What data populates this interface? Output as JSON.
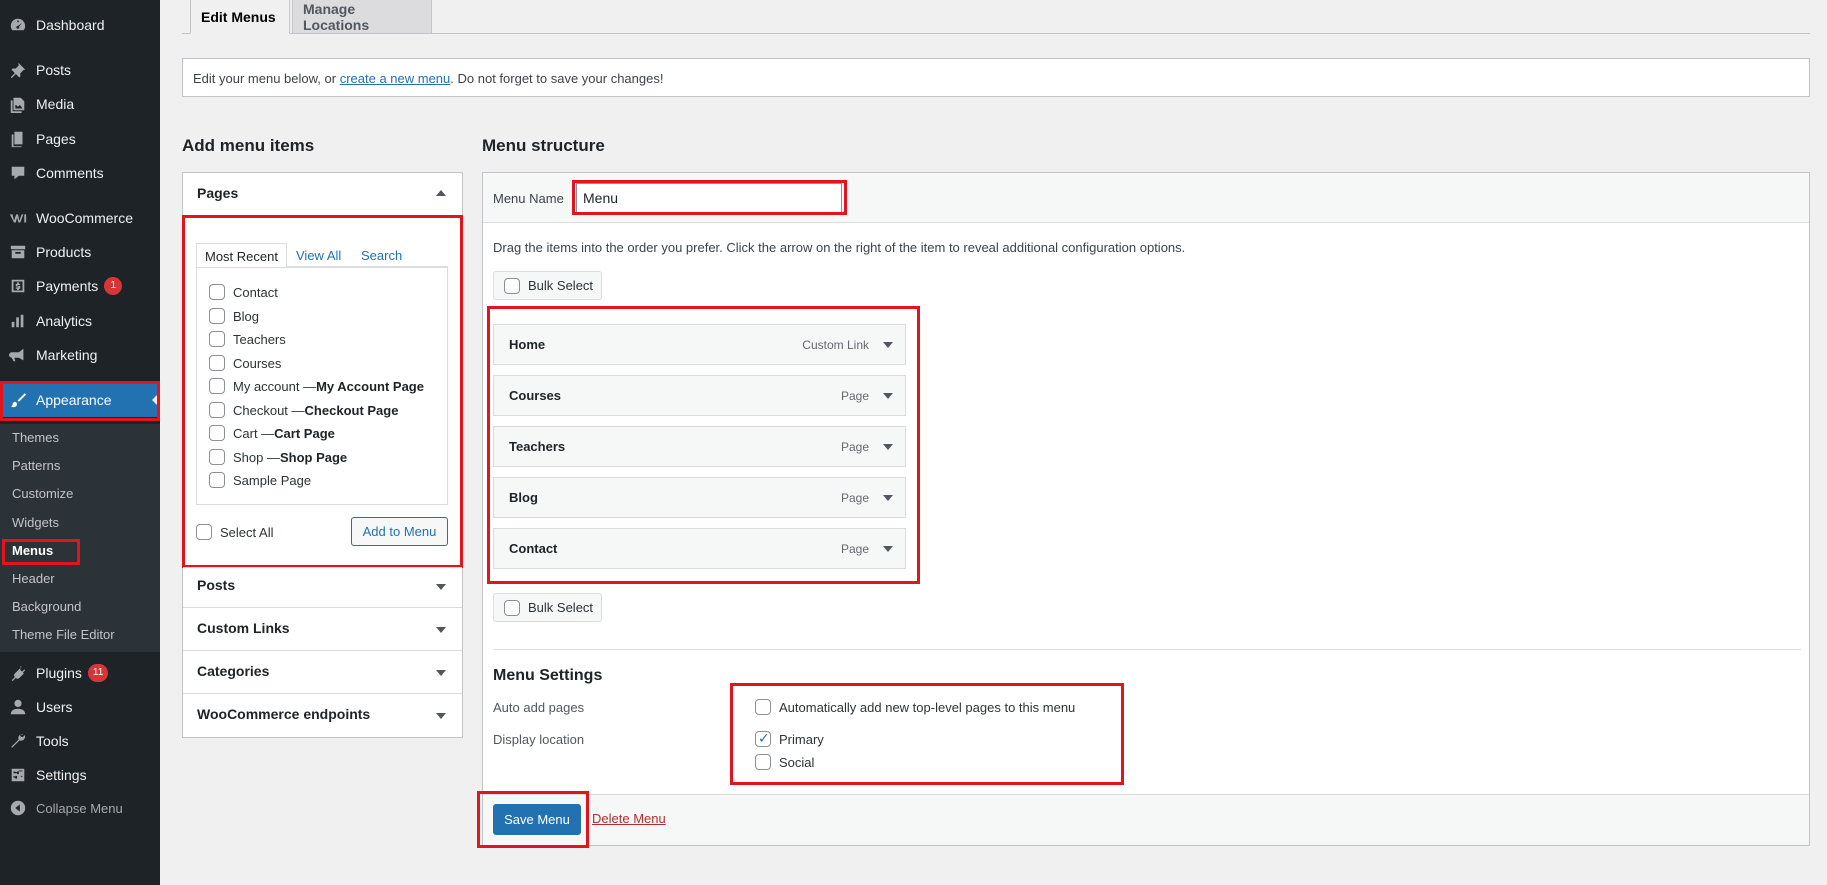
{
  "sidebar": {
    "items": [
      {
        "label": "Dashboard",
        "icon": "dashboard-icon"
      },
      {
        "label": "Posts",
        "icon": "pushpin-icon"
      },
      {
        "label": "Media",
        "icon": "media-icon"
      },
      {
        "label": "Pages",
        "icon": "pages-icon"
      },
      {
        "label": "Comments",
        "icon": "comment-icon"
      },
      {
        "label": "WooCommerce",
        "icon": "woocommerce-icon"
      },
      {
        "label": "Products",
        "icon": "archive-icon"
      },
      {
        "label": "Payments",
        "icon": "payments-icon",
        "badge": "1"
      },
      {
        "label": "Analytics",
        "icon": "bar-chart-icon"
      },
      {
        "label": "Marketing",
        "icon": "megaphone-icon"
      },
      {
        "label": "Appearance",
        "icon": "paintbrush-icon"
      },
      {
        "label": "Plugins",
        "icon": "plugin-icon",
        "badge": "11"
      },
      {
        "label": "Users",
        "icon": "user-icon"
      },
      {
        "label": "Tools",
        "icon": "wrench-icon"
      },
      {
        "label": "Settings",
        "icon": "settings-icon"
      },
      {
        "label": "Collapse Menu",
        "icon": "collapse-icon"
      }
    ],
    "appearance_submenu": [
      "Themes",
      "Patterns",
      "Customize",
      "Widgets",
      "Menus",
      "Header",
      "Background",
      "Theme File Editor"
    ]
  },
  "tabs": [
    "Edit Menus",
    "Manage Locations"
  ],
  "notice": {
    "before": "Edit your menu below, or ",
    "link": "create a new menu",
    "after": ". Do not forget to save your changes!"
  },
  "add_items": {
    "heading": "Add menu items",
    "pages": {
      "title": "Pages",
      "subtabs": [
        "Most Recent",
        "View All",
        "Search"
      ],
      "items": [
        {
          "label": "Contact",
          "suffix": ""
        },
        {
          "label": "Blog",
          "suffix": ""
        },
        {
          "label": "Teachers",
          "suffix": ""
        },
        {
          "label": "Courses",
          "suffix": ""
        },
        {
          "label": "My account — ",
          "suffix": "My Account Page"
        },
        {
          "label": "Checkout — ",
          "suffix": "Checkout Page"
        },
        {
          "label": "Cart — ",
          "suffix": "Cart Page"
        },
        {
          "label": "Shop — ",
          "suffix": "Shop Page"
        },
        {
          "label": "Sample Page",
          "suffix": ""
        }
      ],
      "select_all": "Select All",
      "add_button": "Add to Menu"
    },
    "other_sections": [
      "Posts",
      "Custom Links",
      "Categories",
      "WooCommerce endpoints"
    ]
  },
  "structure": {
    "heading": "Menu structure",
    "menu_name_label": "Menu Name",
    "menu_name_value": "Menu",
    "instructions": "Drag the items into the order you prefer. Click the arrow on the right of the item to reveal additional configuration options.",
    "bulk_select": "Bulk Select",
    "items": [
      {
        "title": "Home",
        "type": "Custom Link"
      },
      {
        "title": "Courses",
        "type": "Page"
      },
      {
        "title": "Teachers",
        "type": "Page"
      },
      {
        "title": "Blog",
        "type": "Page"
      },
      {
        "title": "Contact",
        "type": "Page"
      }
    ],
    "settings": {
      "heading": "Menu Settings",
      "auto_add_label": "Auto add pages",
      "auto_add_option": "Automatically add new top-level pages to this menu",
      "auto_add_checked": false,
      "display_location_label": "Display location",
      "locations": [
        {
          "label": "Primary",
          "checked": true
        },
        {
          "label": "Social",
          "checked": false
        }
      ]
    },
    "save_button": "Save Menu",
    "delete_link": "Delete Menu"
  },
  "colors": {
    "sidebar_bg": "#1d2327",
    "accent": "#2271b1",
    "badge": "#d63638",
    "highlight": "#e3141b"
  }
}
